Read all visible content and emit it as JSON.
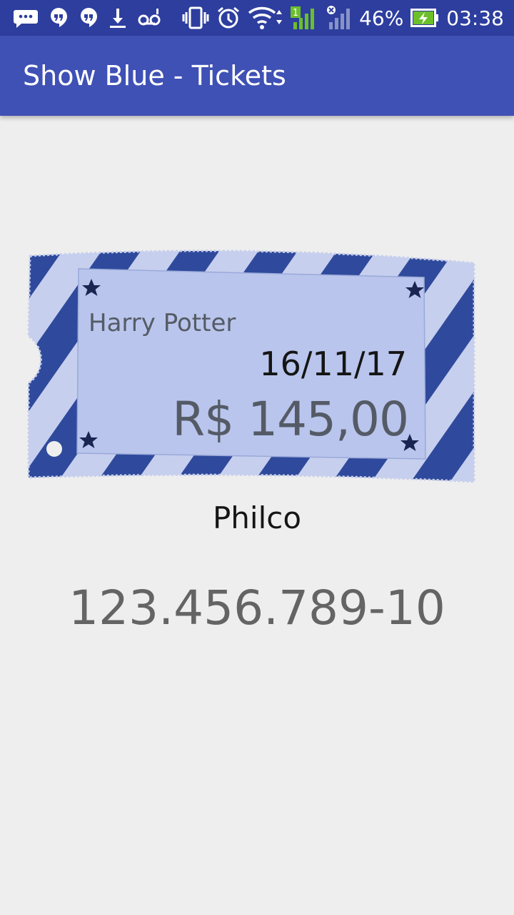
{
  "status_bar": {
    "battery_percent": "46%",
    "time": "03:38",
    "sim_label": "1",
    "icons": [
      "messages-icon",
      "hangouts-icon",
      "hangouts-icon",
      "download-icon",
      "voicemail-icon",
      "vibrate-icon",
      "alarm-icon",
      "wifi-icon",
      "signal-icon",
      "no-signal-icon",
      "battery-charging-icon"
    ]
  },
  "app_bar": {
    "title": "Show Blue - Tickets"
  },
  "ticket": {
    "show_name": "Harry Potter",
    "date": "16/11/17",
    "price": "R$ 145,00",
    "colors": {
      "stripe_dark": "#2f4a9c",
      "stripe_light": "#c7cfee",
      "inner": "#b9c5ec"
    }
  },
  "venue": "Philco",
  "ticket_code": "123.456.789-10",
  "colors": {
    "status_bar": "#2d3e9e",
    "app_bar": "#3f51b5",
    "background": "#eeeeee"
  }
}
